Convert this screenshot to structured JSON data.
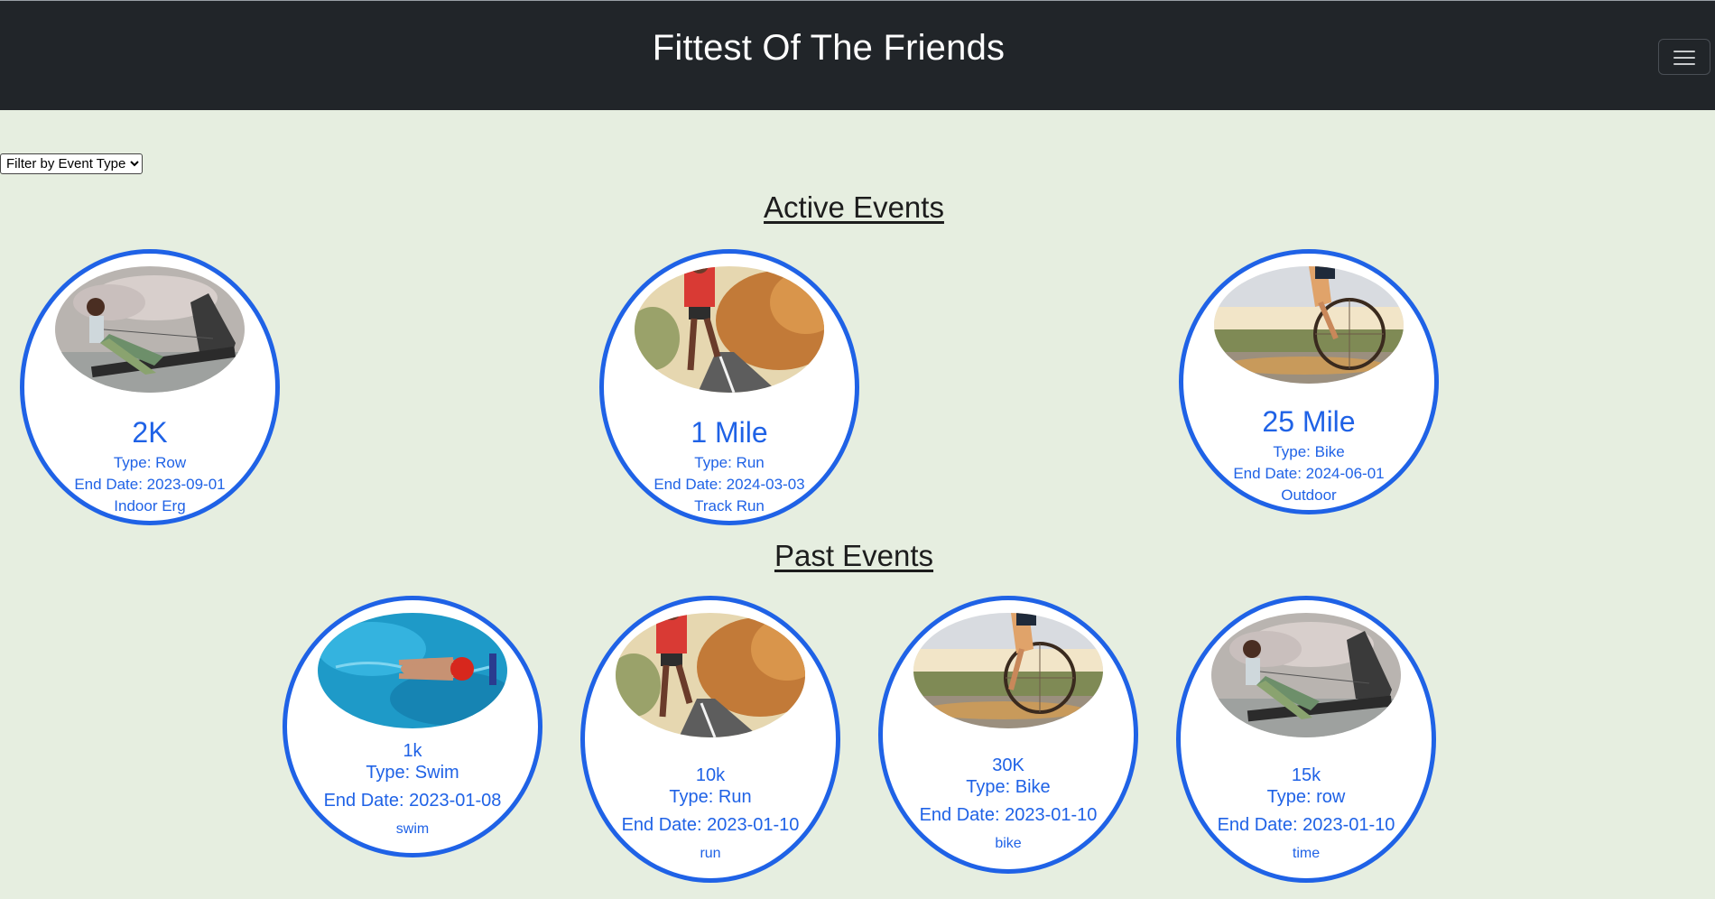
{
  "app": {
    "title": "Fittest Of The Friends"
  },
  "filter": {
    "label": "Filter by Event Type"
  },
  "sections": {
    "active_title": "Active Events",
    "past_title": "Past Events"
  },
  "active_events": [
    {
      "name": "2K",
      "type": "Type: Row",
      "end_date": "End Date: 2023-09-01",
      "note": "Indoor Erg",
      "image": "rowing-photo"
    },
    {
      "name": "1 Mile",
      "type": "Type: Run",
      "end_date": "End Date: 2024-03-03",
      "note": "Track Run",
      "image": "running-photo"
    },
    {
      "name": "25 Mile",
      "type": "Type: Bike",
      "end_date": "End Date: 2024-06-01",
      "note": "Outdoor",
      "image": "cycling-photo"
    }
  ],
  "past_events": [
    {
      "name": "1k",
      "type": "Type: Swim",
      "end_date": "End Date: 2023-01-08",
      "note": "swim",
      "image": "swimming-photo"
    },
    {
      "name": "10k",
      "type": "Type: Run",
      "end_date": "End Date: 2023-01-10",
      "note": "run",
      "image": "running-photo"
    },
    {
      "name": "30K",
      "type": "Type: Bike",
      "end_date": "End Date: 2023-01-10",
      "note": "bike",
      "image": "cycling-photo"
    },
    {
      "name": "15k",
      "type": "Type: row",
      "end_date": "End Date: 2023-01-10",
      "note": "time",
      "image": "rowing-photo"
    }
  ],
  "colors": {
    "navbar": "#212529",
    "background": "#e6eee0",
    "accent": "#1f62e6"
  },
  "icons": {
    "menu": "hamburger-icon",
    "dropdown": "chevron-down-icon"
  }
}
